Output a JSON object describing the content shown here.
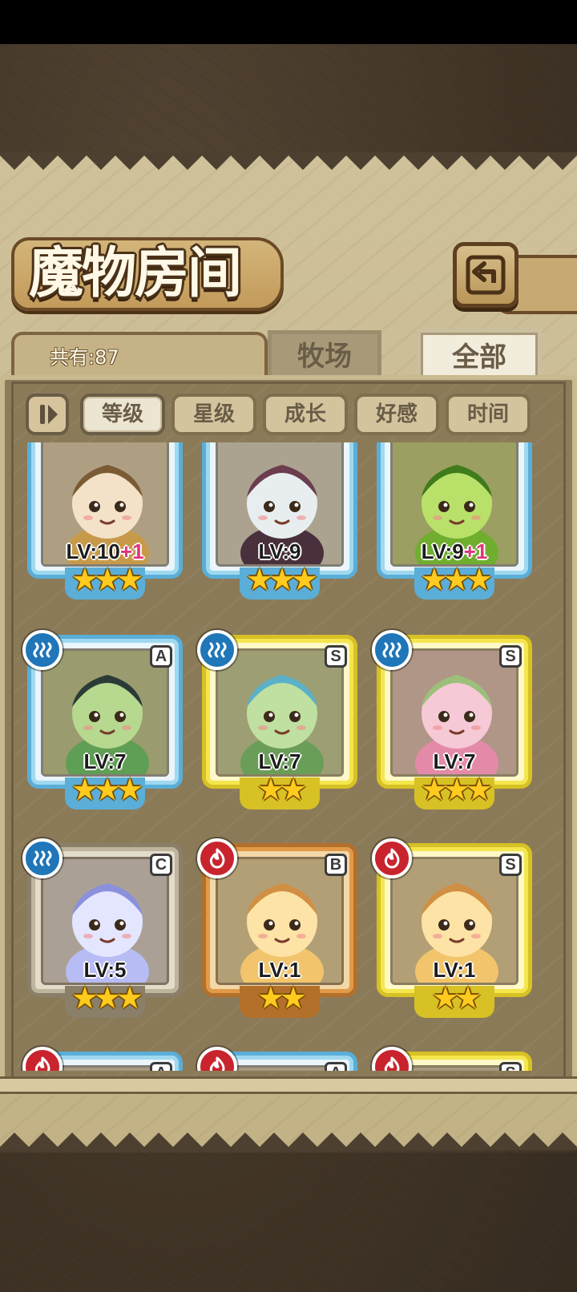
{
  "screen": {
    "title": "魔物房间"
  },
  "header": {
    "count_label": "共有:87",
    "tabs": [
      {
        "label": "牧场",
        "active": false
      },
      {
        "label": "全部",
        "active": true
      }
    ]
  },
  "sort": {
    "toggle_icon": "sort-direction-icon",
    "buttons": [
      {
        "label": "等级",
        "selected": true
      },
      {
        "label": "星级",
        "selected": false
      },
      {
        "label": "成长",
        "selected": false
      },
      {
        "label": "好感",
        "selected": false
      },
      {
        "label": "时间",
        "selected": false
      }
    ]
  },
  "monsters": [
    {
      "level_text": "LV:10",
      "bonus": "+1",
      "stars": 3,
      "frame": "blue",
      "rank": "",
      "element": "",
      "palette": [
        "#f3e2c8",
        "#c79a4a",
        "#7a5b34"
      ]
    },
    {
      "level_text": "LV:9",
      "bonus": "",
      "stars": 3,
      "frame": "blue",
      "rank": "",
      "element": "",
      "palette": [
        "#e8eef0",
        "#4a2f3c",
        "#6b3d4f"
      ]
    },
    {
      "level_text": "LV:9",
      "bonus": "+1",
      "stars": 3,
      "frame": "blue",
      "rank": "",
      "element": "",
      "palette": [
        "#b9e16a",
        "#6fae2e",
        "#3f7a1c"
      ]
    },
    {
      "level_text": "LV:7",
      "bonus": "",
      "stars": 3,
      "frame": "blue",
      "rank": "A",
      "element": "water",
      "palette": [
        "#b6d88f",
        "#5f9e55",
        "#2b3b35"
      ]
    },
    {
      "level_text": "LV:7",
      "bonus": "",
      "stars": 2,
      "frame": "gold",
      "rank": "S",
      "element": "water",
      "palette": [
        "#bfe0a0",
        "#6a9e58",
        "#5ab1c9"
      ]
    },
    {
      "level_text": "LV:7",
      "bonus": "",
      "stars": 3,
      "frame": "gold",
      "rank": "S",
      "element": "water",
      "palette": [
        "#f6c9d6",
        "#e48aa9",
        "#9cc07a"
      ]
    },
    {
      "level_text": "LV:5",
      "bonus": "",
      "stars": 3,
      "frame": "grey",
      "rank": "C",
      "element": "water",
      "palette": [
        "#e4e6ff",
        "#b7bcf4",
        "#8a90dc"
      ]
    },
    {
      "level_text": "LV:1",
      "bonus": "",
      "stars": 2,
      "frame": "bronze",
      "rank": "B",
      "element": "fire",
      "palette": [
        "#fde3a6",
        "#f2c46c",
        "#d18f44"
      ]
    },
    {
      "level_text": "LV:1",
      "bonus": "",
      "stars": 2,
      "frame": "gold",
      "rank": "S",
      "element": "fire",
      "palette": [
        "#fde3a6",
        "#f2c46c",
        "#d18f44"
      ]
    },
    {
      "level_text": "",
      "bonus": "",
      "stars": 0,
      "frame": "blue",
      "rank": "A",
      "element": "fire",
      "palette": [
        "#d7d0bf",
        "#bdb29a",
        "#9b8f75"
      ]
    },
    {
      "level_text": "",
      "bonus": "",
      "stars": 0,
      "frame": "blue",
      "rank": "A",
      "element": "fire",
      "palette": [
        "#d7d0bf",
        "#bdb29a",
        "#9b8f75"
      ]
    },
    {
      "level_text": "",
      "bonus": "",
      "stars": 0,
      "frame": "gold",
      "rank": "S",
      "element": "fire",
      "palette": [
        "#d7d0bf",
        "#bdb29a",
        "#9b8f75"
      ]
    }
  ],
  "icons": {
    "back": "return-arrow-icon",
    "water": "water-wave-icon",
    "fire": "flame-icon",
    "star": "star-icon"
  },
  "colors": {
    "parchment": "#c7b88f",
    "panel": "#8b7a58",
    "water": "#1f76b8",
    "fire": "#c9242e",
    "star": "#ffcb1f",
    "level_bonus": "#e0347a"
  }
}
